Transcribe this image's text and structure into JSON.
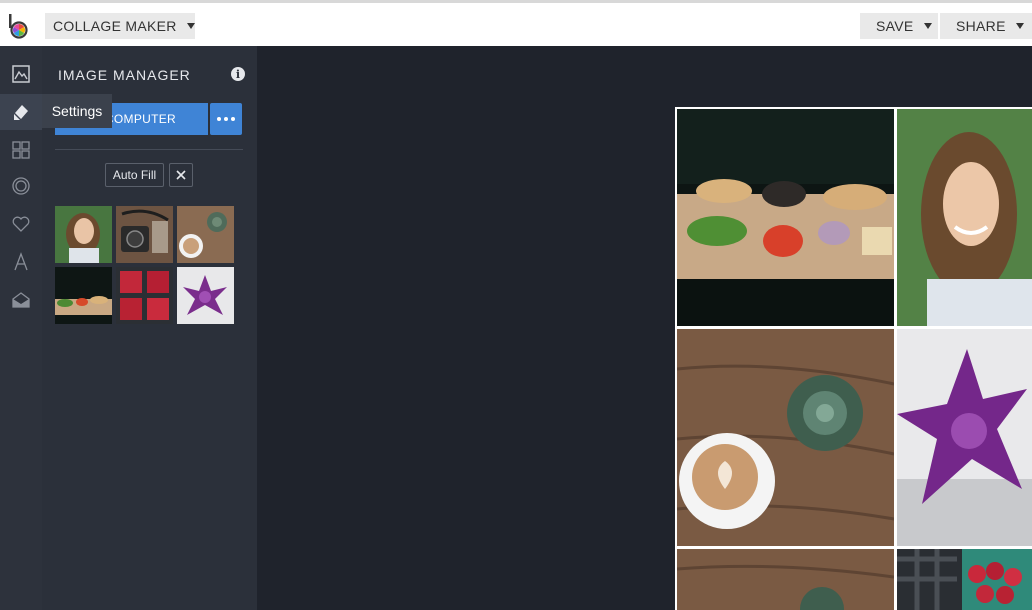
{
  "header": {
    "mode_label": "COLLAGE MAKER",
    "save_label": "SAVE",
    "share_label": "SHARE"
  },
  "rail": {
    "items": [
      "edit-icon",
      "settings-icon",
      "layout-icon",
      "frames-icon",
      "stickers-icon",
      "text-icon",
      "background-icon"
    ],
    "tooltip": "Settings"
  },
  "panel": {
    "title": "IMAGE MANAGER",
    "computer_label": "COMPUTER",
    "autofill_label": "Auto Fill",
    "thumbnails": [
      "woman-portrait",
      "camera-bag",
      "latte-succulent",
      "burger-prep",
      "raspberries",
      "purple-succulent"
    ]
  },
  "collage": {
    "cells": [
      "burger-prep",
      "woman-portrait",
      "latte-succulent",
      "purple-succulent",
      "wood-succulent",
      "raspberries"
    ]
  },
  "colors": {
    "accent": "#3f84d6",
    "panel": "#2b303a",
    "rail": "#2d323c",
    "canvas": "#1f232c"
  }
}
